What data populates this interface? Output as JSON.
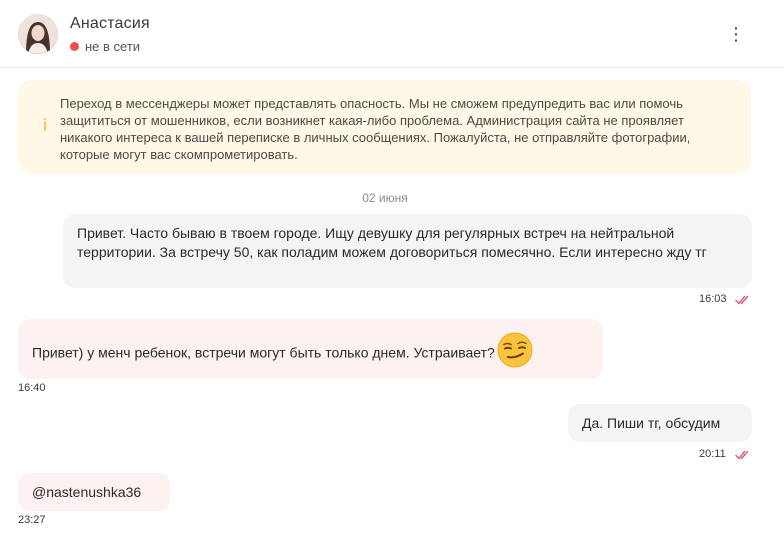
{
  "header": {
    "contact_name": "Анастасия",
    "status_text": "не в сети",
    "status_color": "#f04e4e",
    "menu_icon": "⋮"
  },
  "warning": {
    "icon": "i",
    "text": "Переход в мессенджеры может представлять опасность. Мы не сможем предупредить вас или помочь защититься от мошенников, если возникнет какая-либо проблема. Администрация сайта не проявляет никакого интереса к вашей переписке в личных сообщениях. Пожалуйста, не отправляйте фотографии, которые могут вас скомпрометировать.",
    "background": "#fff8e6",
    "icon_color": "#f5b83d"
  },
  "date_separator": "02 июня",
  "messages": [
    {
      "direction": "outgoing",
      "text": "Привет. Часто бываю в твоем городе. Ищу девушку для регулярных встреч на нейтральной территории. За встречу 50, как поладим можем договориться помесячно. Если интересно жду тг",
      "time": "16:03",
      "read": true
    },
    {
      "direction": "incoming",
      "text": "Привет) у менч ребенок, встречи могут быть только днем. Устраивает?",
      "emoji": "smirking-face-emoji",
      "time": "16:40"
    },
    {
      "direction": "outgoing",
      "text": "Да. Пиши тг, обсудим",
      "time": "20:11",
      "read": true
    },
    {
      "direction": "incoming",
      "text": "@nastenushka36",
      "time": "23:27"
    }
  ],
  "colors": {
    "read_check": "#e0506e",
    "outgoing_bubble": "#f4f4f5",
    "incoming_bubble": "#fdf1f1"
  }
}
